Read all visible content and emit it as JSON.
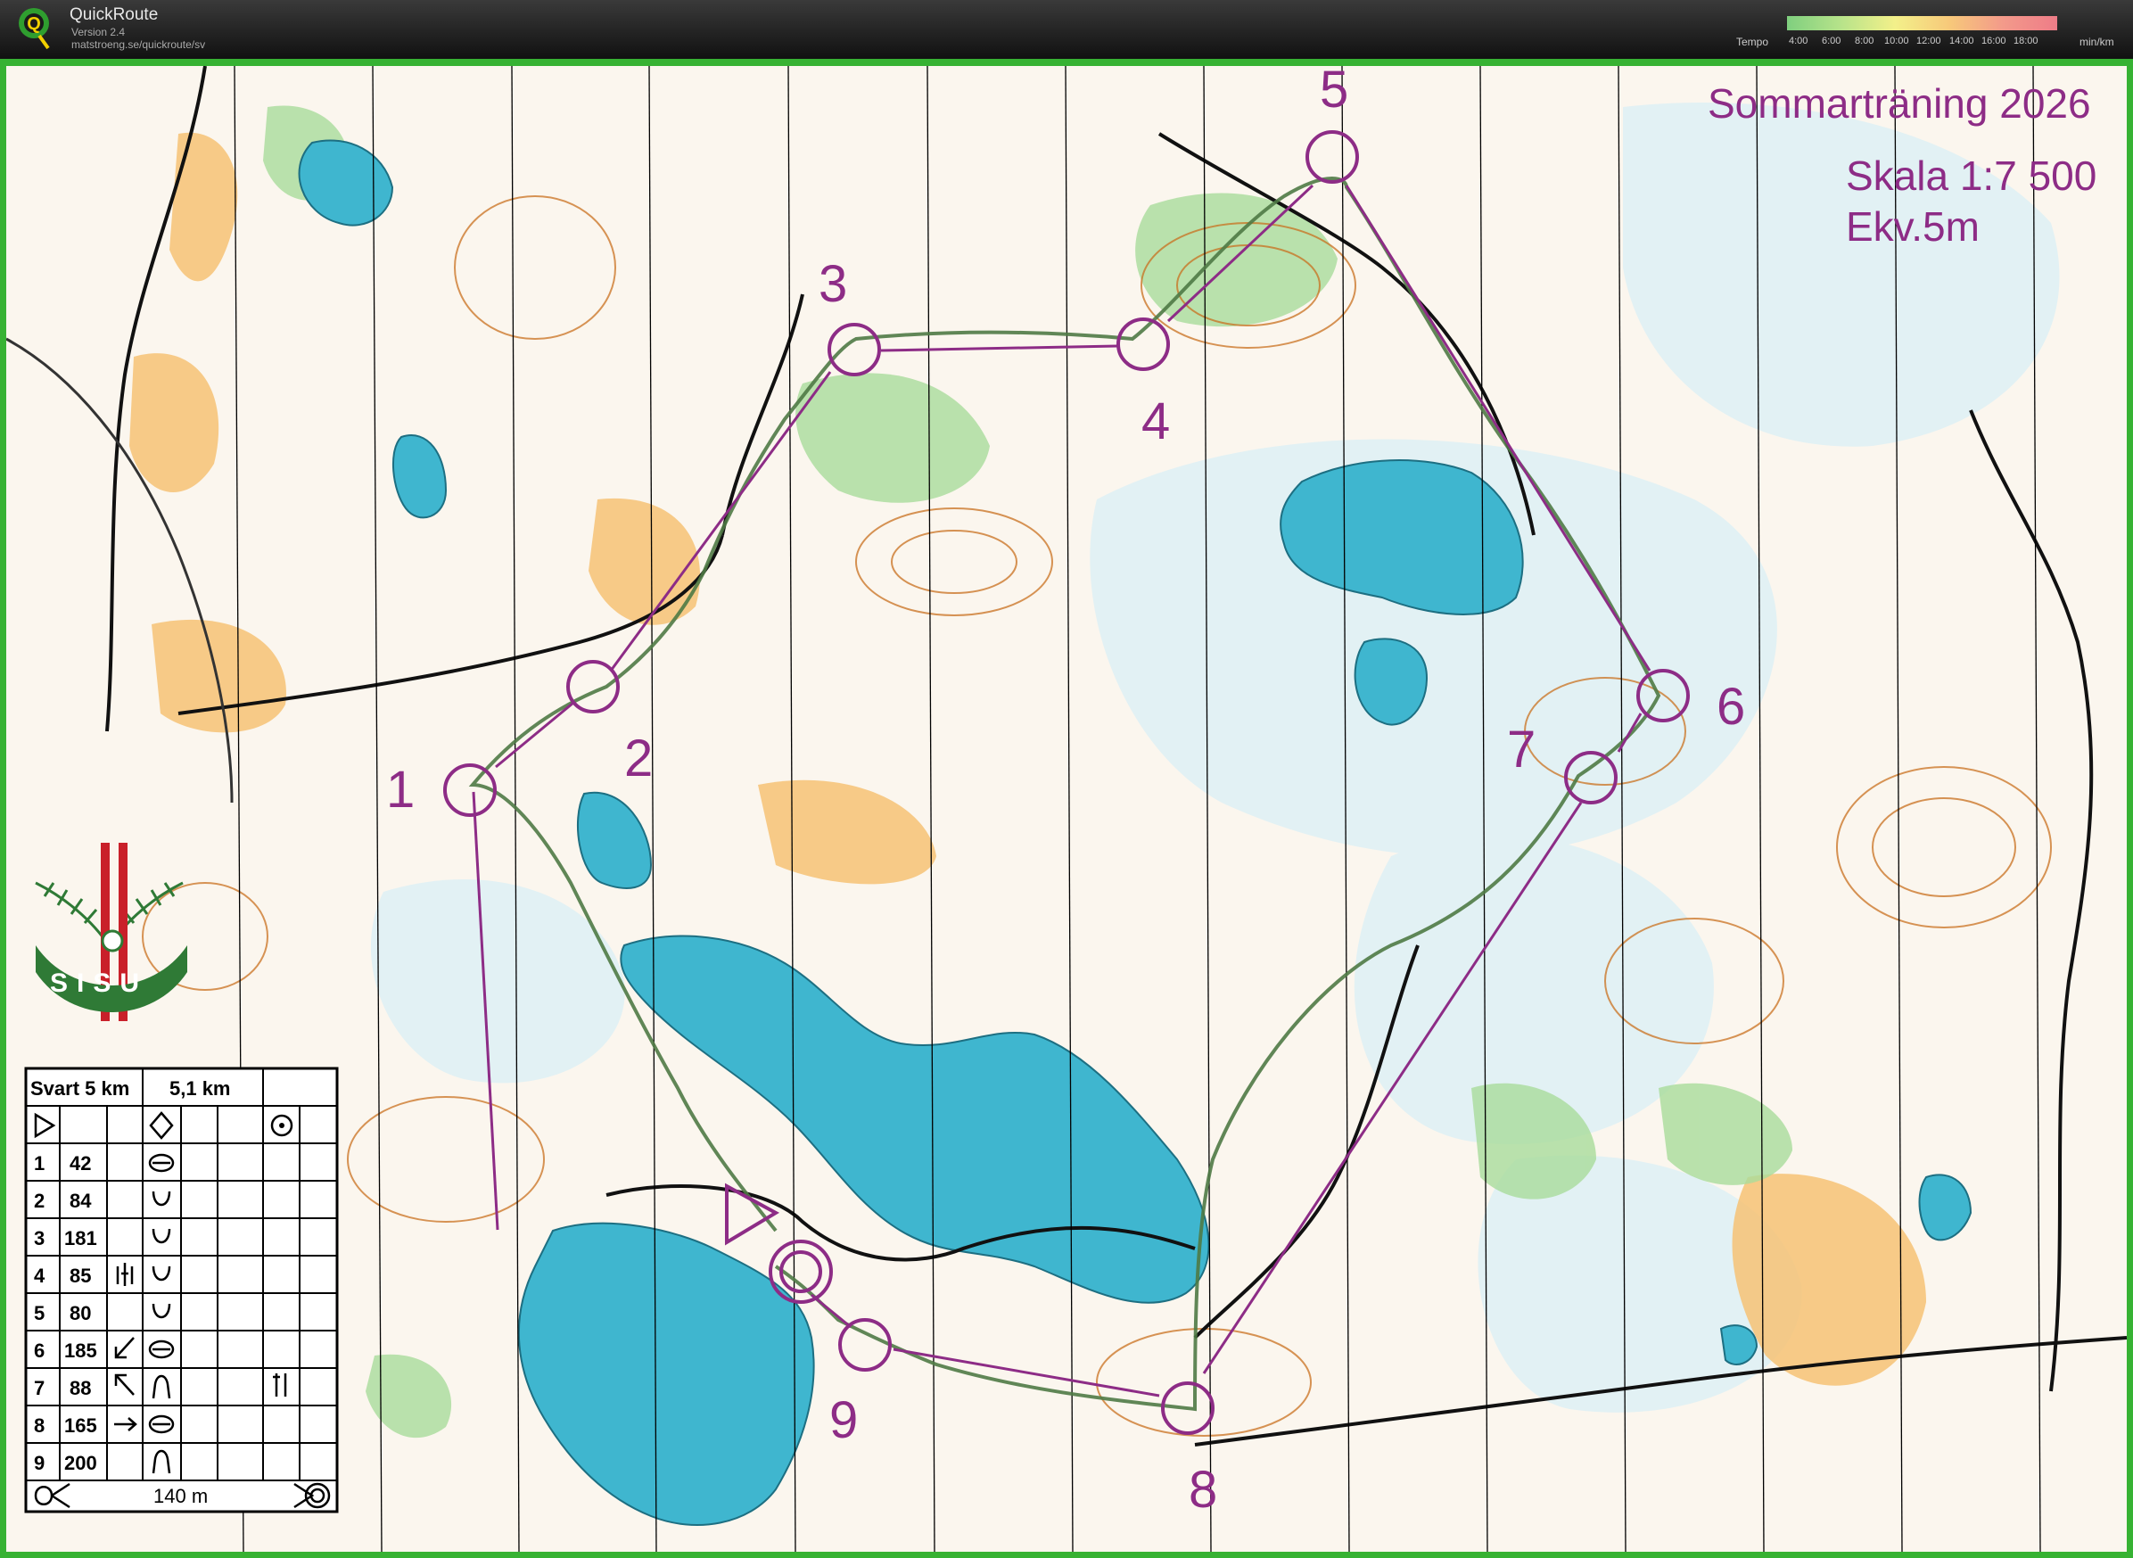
{
  "app": {
    "name": "QuickRoute",
    "version": "Version 2.4",
    "url": "matstroeng.se/quickroute/sv",
    "tempo_label": "Tempo",
    "tempo_ticks": [
      "4:00",
      "6:00",
      "8:00",
      "10:00",
      "12:00",
      "14:00",
      "16:00",
      "18:00"
    ],
    "tempo_unit": "min/km"
  },
  "map": {
    "title": "Sommarträning 2026",
    "scale": "Skala 1:7 500",
    "contour": "Ekv.5m",
    "club_logo_text": "SISU",
    "colors": {
      "course": "#8d2c86",
      "route": "#4f7a45",
      "water": "#3fb6cf",
      "open": "#f3b24d",
      "forest_green": "#7fcf7f",
      "contour": "#c9701f",
      "road": "#111111",
      "frame": "#37b233"
    },
    "controls": [
      {
        "label": "1"
      },
      {
        "label": "2"
      },
      {
        "label": "3"
      },
      {
        "label": "4"
      },
      {
        "label": "5"
      },
      {
        "label": "6"
      },
      {
        "label": "7"
      },
      {
        "label": "8"
      },
      {
        "label": "9"
      }
    ]
  },
  "description_sheet": {
    "course": "Svart 5 km",
    "length": "5,1 km",
    "start_symbols": [
      "start-triangle-icon",
      "diamond-icon",
      "circle-dot-icon"
    ],
    "rows": [
      {
        "num": "1",
        "code": "42",
        "dir": "",
        "feat": "hill-icon",
        "extra": ""
      },
      {
        "num": "2",
        "code": "84",
        "dir": "",
        "feat": "depression-icon",
        "extra": ""
      },
      {
        "num": "3",
        "code": "181",
        "dir": "",
        "feat": "depression-icon",
        "extra": ""
      },
      {
        "num": "4",
        "code": "85",
        "dir": "spread-icon",
        "feat": "depression-icon",
        "extra": ""
      },
      {
        "num": "5",
        "code": "80",
        "dir": "",
        "feat": "depression-icon",
        "extra": ""
      },
      {
        "num": "6",
        "code": "185",
        "dir": "arrow-sw-icon",
        "feat": "hill-icon",
        "extra": ""
      },
      {
        "num": "7",
        "code": "88",
        "dir": "arrow-nw-icon",
        "feat": "spur-icon",
        "extra": "bar-icon"
      },
      {
        "num": "8",
        "code": "165",
        "dir": "arrow-e-icon",
        "feat": "hill-icon",
        "extra": ""
      },
      {
        "num": "9",
        "code": "200",
        "dir": "",
        "feat": "spur-icon",
        "extra": ""
      }
    ],
    "finish_distance": "140 m"
  }
}
